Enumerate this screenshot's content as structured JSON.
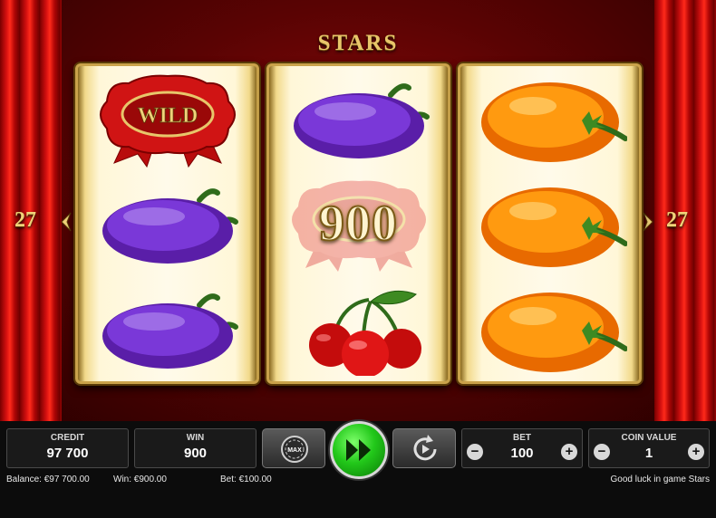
{
  "game": {
    "title": "STARS"
  },
  "paylines": {
    "left": "27",
    "right": "27"
  },
  "reels": [
    [
      "wild",
      "plum",
      "plum"
    ],
    [
      "plum",
      "wild",
      "cherries"
    ],
    [
      "orange",
      "orange",
      "orange"
    ]
  ],
  "symbols": {
    "wild_label": "WILD"
  },
  "win_display": "900",
  "controls": {
    "credit_label": "CREDIT",
    "credit_value": "97 700",
    "win_label": "WIN",
    "win_value": "900",
    "bet_label": "BET",
    "bet_value": "100",
    "coin_label": "COIN VALUE",
    "coin_value": "1",
    "max_label": "MAX",
    "minus": "−",
    "plus": "+"
  },
  "status": {
    "balance": "Balance: €97 700.00",
    "win": "Win: €900.00",
    "bet": "Bet: €100.00",
    "message": "Good luck in game Stars"
  },
  "colors": {
    "gold": "#e8c66a",
    "spin_green": "#22c81a",
    "curtain_red": "#d41010"
  }
}
